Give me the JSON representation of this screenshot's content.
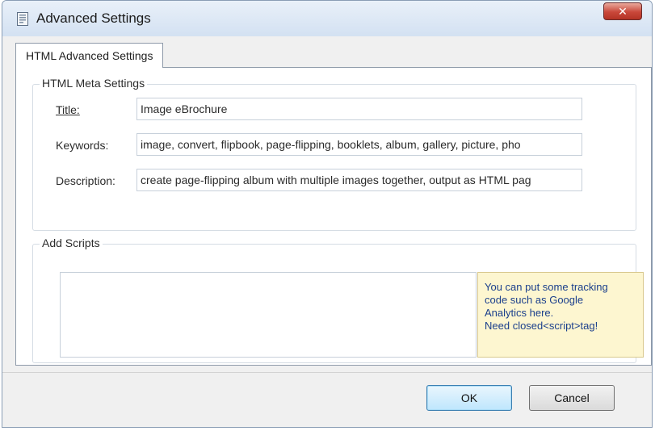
{
  "window": {
    "title": "Advanced Settings",
    "close_label": "✕"
  },
  "tab": {
    "label": "HTML Advanced Settings"
  },
  "meta": {
    "group_label": "HTML Meta Settings",
    "title_label": "Title:",
    "title_value": "Image eBrochure",
    "keywords_label": "Keywords:",
    "keywords_value": "image, convert, flipbook, page-flipping, booklets, album, gallery, picture, pho",
    "description_label": "Description:",
    "description_value": "create page-flipping album with multiple images together, output as HTML pag"
  },
  "scripts": {
    "group_label": "Add Scripts",
    "textarea_value": "",
    "tip_lines": [
      "You can put some tracking",
      "code such as Google",
      "Analytics here.",
      "Need closed<script>tag!"
    ]
  },
  "buttons": {
    "ok": "OK",
    "cancel": "Cancel"
  },
  "icons": {
    "app": "document-settings-icon",
    "close": "close-icon"
  },
  "colors": {
    "titlebar": "#d3e1f2",
    "close_button": "#c9473a",
    "tip_background": "#fdf6d0",
    "tip_text": "#1b3f8c",
    "default_button_border": "#3c7fb1"
  }
}
